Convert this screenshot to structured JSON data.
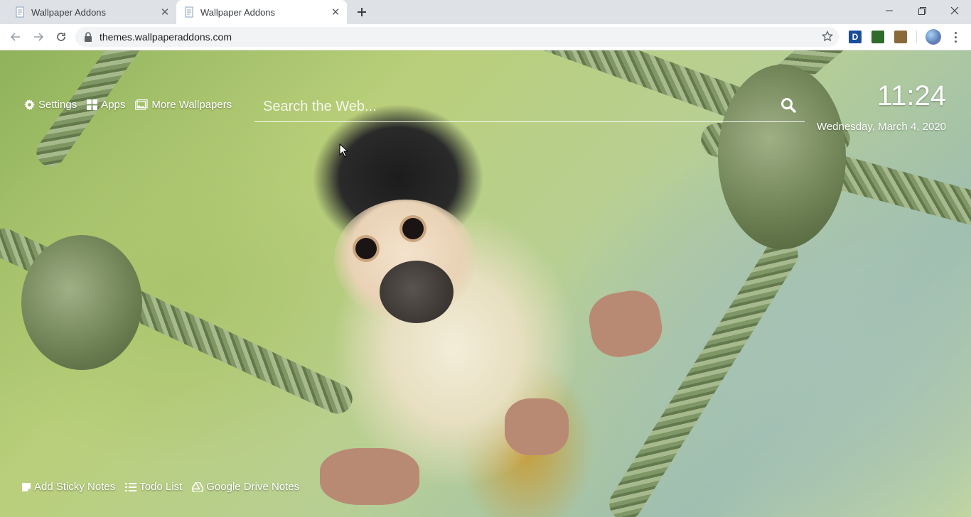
{
  "tabs": [
    {
      "title": "Wallpaper Addons",
      "active": false
    },
    {
      "title": "Wallpaper Addons",
      "active": true
    }
  ],
  "icons": {
    "new_tab": "plus-icon",
    "minimize": "minimize-icon",
    "maximize": "restore-icon",
    "close": "close-icon",
    "back": "arrow-left-icon",
    "forward": "arrow-right-icon",
    "reload": "reload-icon",
    "lock": "lock-icon",
    "star": "star-icon",
    "menu": "kebab-menu-icon"
  },
  "address_bar": {
    "url": "themes.wallpaperaddons.com"
  },
  "extensions": [
    {
      "label": "D",
      "color": "#1a4c9c"
    },
    {
      "label": "",
      "color": "#2f6b2a"
    },
    {
      "label": "",
      "color": "#8a6a3a"
    }
  ],
  "page": {
    "top_links": {
      "settings": "Settings",
      "apps": "Apps",
      "more_wallpapers": "More Wallpapers"
    },
    "search": {
      "placeholder": "Search the Web..."
    },
    "clock": {
      "time": "11:24",
      "date": "Wednesday, March 4, 2020"
    },
    "bottom_links": {
      "sticky_notes": "Add Sticky Notes",
      "todo": "Todo List",
      "drive_notes": "Google Drive Notes"
    }
  },
  "colors": {
    "chrome_bg": "#dee1e6",
    "omnibox_bg": "#f1f3f4",
    "text_white": "#ffffff"
  }
}
